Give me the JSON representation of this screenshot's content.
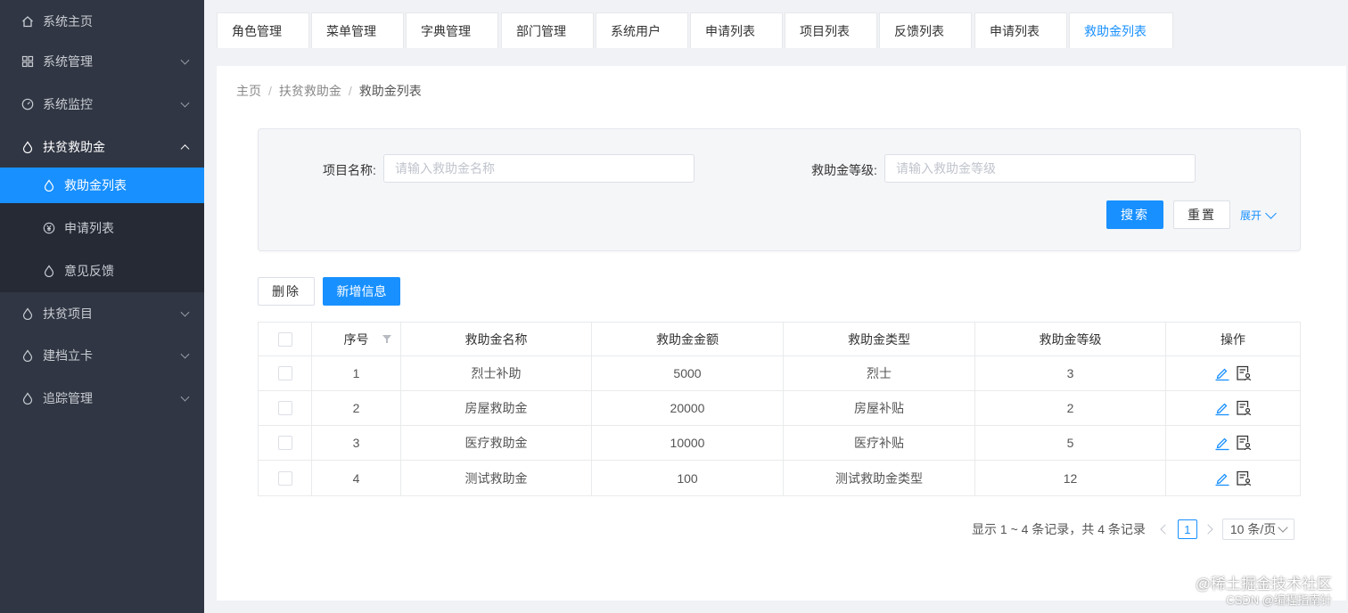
{
  "sidebar": {
    "items": [
      {
        "label": "系统主页",
        "icon": "home-icon"
      },
      {
        "label": "系统管理",
        "icon": "grid-icon"
      },
      {
        "label": "系统监控",
        "icon": "gauge-icon"
      },
      {
        "label": "扶贫救助金",
        "icon": "drop-icon"
      },
      {
        "label": "扶贫项目",
        "icon": "drop-icon"
      },
      {
        "label": "建档立卡",
        "icon": "drop-icon"
      },
      {
        "label": "追踪管理",
        "icon": "drop-icon"
      }
    ],
    "subitems": [
      {
        "label": "救助金列表",
        "icon": "drop-icon"
      },
      {
        "label": "申请列表",
        "icon": "yen-icon"
      },
      {
        "label": "意见反馈",
        "icon": "drop-icon"
      }
    ]
  },
  "tabs": [
    "角色管理",
    "菜单管理",
    "字典管理",
    "部门管理",
    "系统用户",
    "申请列表",
    "项目列表",
    "反馈列表",
    "申请列表",
    "救助金列表"
  ],
  "breadcrumb": {
    "home": "主页",
    "parent": "扶贫救助金",
    "current": "救助金列表",
    "separator": "/"
  },
  "search": {
    "name_label": "项目名称:",
    "name_placeholder": "请输入救助金名称",
    "level_label": "救助金等级:",
    "level_placeholder": "请输入救助金等级",
    "search_button": "搜索",
    "reset_button": "重置",
    "expand_link": "展开"
  },
  "toolbar": {
    "delete_button": "删除",
    "add_button": "新增信息"
  },
  "table": {
    "headers": [
      "序号",
      "救助金名称",
      "救助金金额",
      "救助金类型",
      "救助金等级",
      "操作"
    ],
    "rows": [
      {
        "no": "1",
        "name": "烈士补助",
        "amount": "5000",
        "type": "烈士",
        "level": "3"
      },
      {
        "no": "2",
        "name": "房屋救助金",
        "amount": "20000",
        "type": "房屋补贴",
        "level": "2"
      },
      {
        "no": "3",
        "name": "医疗救助金",
        "amount": "10000",
        "type": "医疗补贴",
        "level": "5"
      },
      {
        "no": "4",
        "name": "测试救助金",
        "amount": "100",
        "type": "测试救助金类型",
        "level": "12"
      }
    ]
  },
  "pagination": {
    "summary": "显示 1 ~ 4 条记录，共 4 条记录",
    "current_page": "1",
    "page_size": "10 条/页"
  },
  "watermark": {
    "line1": "@稀土掘金技术社区",
    "line2": "CSDN @编程指南针"
  },
  "colors": {
    "sidebar_bg": "#303643",
    "accent": "#1890ff"
  }
}
